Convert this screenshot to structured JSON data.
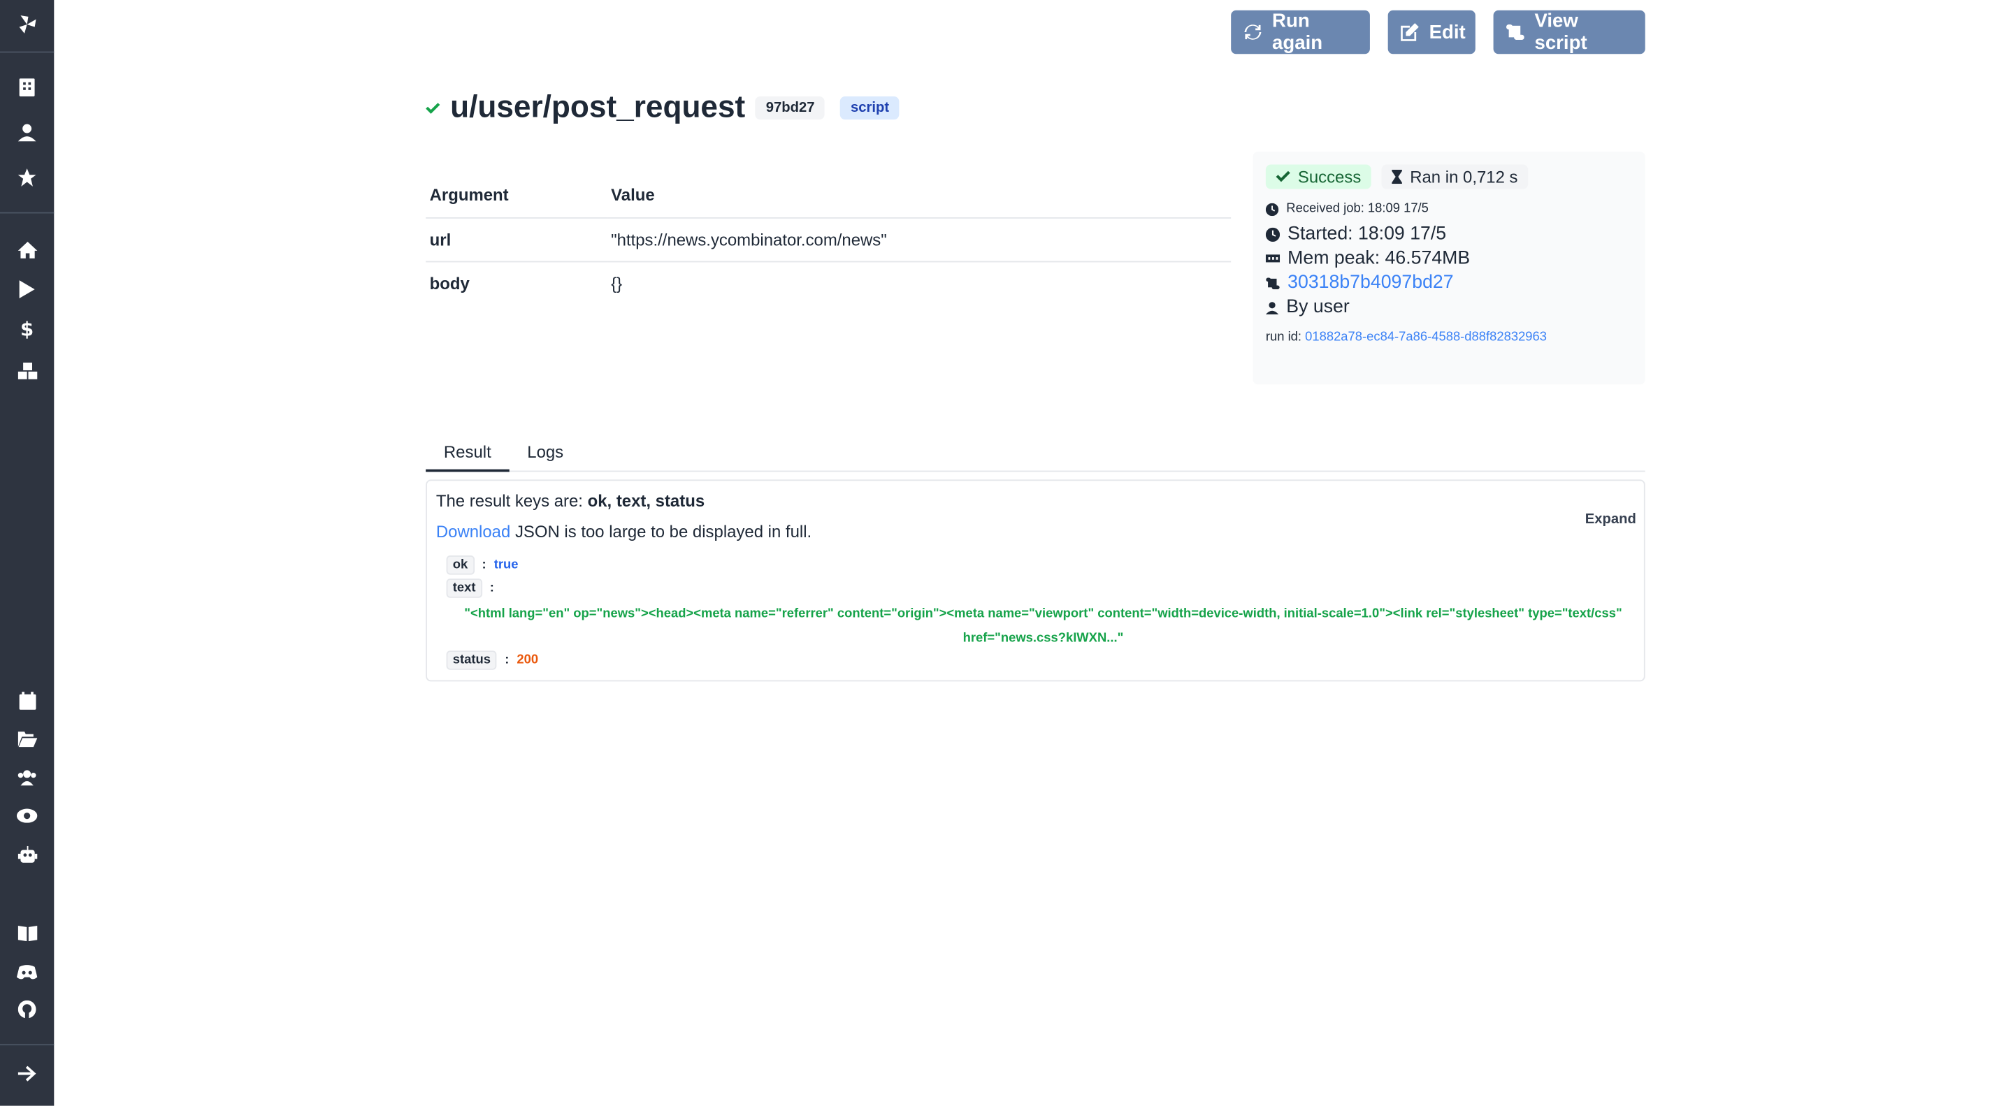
{
  "header": {
    "run_again": "Run again",
    "edit": "Edit",
    "view_script": "View script"
  },
  "job": {
    "path": "u/user/post_request",
    "hash": "97bd27",
    "kind": "script"
  },
  "args": {
    "col_argument": "Argument",
    "col_value": "Value",
    "rows": [
      {
        "name": "url",
        "value": "\"https://news.ycombinator.com/news\""
      },
      {
        "name": "body",
        "value": "{}"
      }
    ]
  },
  "info": {
    "status": "Success",
    "duration": "Ran in 0,712 s",
    "received": "Received job: 18:09 17/5",
    "started": "Started: 18:09 17/5",
    "mem": "Mem peak: 46.574MB",
    "script_hash": "30318b7b4097bd27",
    "by": "By user",
    "run_id_label": "run id:",
    "run_id": "01882a78-ec84-7a86-4588-d88f82832963"
  },
  "tabs": [
    "Result",
    "Logs"
  ],
  "result": {
    "keys_prefix": "The result keys are:",
    "keys": "ok, text, status",
    "download": "Download",
    "too_large": "JSON is too large to be displayed in full.",
    "expand": "Expand",
    "ok_key": "ok",
    "ok_val": "true",
    "text_key": "text",
    "text_val": "\"<html lang=\"en\" op=\"news\"><head><meta name=\"referrer\" content=\"origin\"><meta name=\"viewport\" content=\"width=device-width, initial-scale=1.0\"><link rel=\"stylesheet\" type=\"text/css\" href=\"news.css?kIWXN...\"",
    "status_key": "status",
    "status_val": "200",
    "colon": ":"
  },
  "colors": {
    "sidebar": "#2e3440",
    "button": "#6b87b0",
    "success": "#166534",
    "link": "#3b82f6"
  }
}
